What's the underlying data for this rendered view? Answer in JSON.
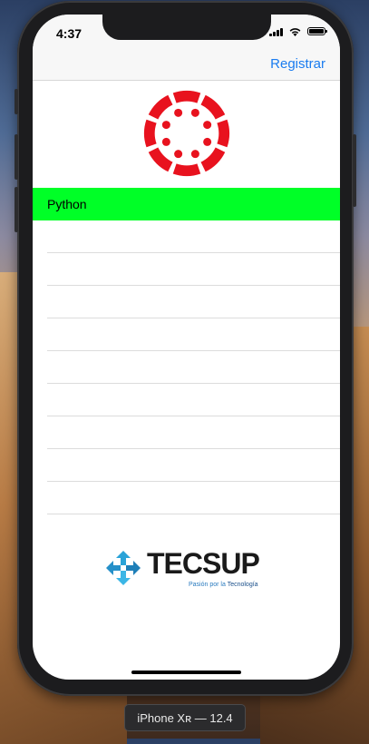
{
  "status_bar": {
    "time": "4:37"
  },
  "navbar": {
    "action_label": "Registrar"
  },
  "logo": {
    "name": "canvas-lms-logo",
    "color": "#e8121e"
  },
  "list": {
    "items": [
      {
        "label": "Python",
        "selected": true
      }
    ],
    "empty_rows": 9,
    "selected_color": "#00ff27"
  },
  "footer_logo": {
    "word": "TECSUP",
    "tagline_prefix": "Pasión por la",
    "tagline_suffix": "Tecnología"
  },
  "simulator": {
    "device_label": "iPhone Xʀ — 12.4"
  },
  "colors": {
    "accent": "#1a7cf0",
    "logo_red": "#e8121e"
  }
}
